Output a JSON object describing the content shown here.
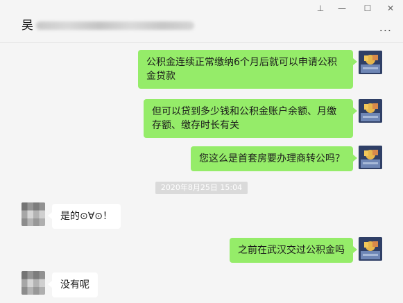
{
  "header": {
    "title": "吴",
    "more_label": "..."
  },
  "window_controls": {
    "pin": "⊥",
    "minimize": "—",
    "maximize": "☐",
    "close": "✕"
  },
  "messages": [
    {
      "from": "self",
      "text": "公积金连续正常缴纳6个月后就可以申请公积金贷款"
    },
    {
      "from": "self",
      "text": "但可以贷到多少钱和公积金账户余额、月缴存额、缴存时长有关"
    },
    {
      "from": "self",
      "text": "您这么是首套房要办理商转公吗？"
    },
    {
      "from": "other",
      "text": "是的⊙∀⊙！"
    },
    {
      "from": "self",
      "text": "之前在武汉交过公积金吗"
    },
    {
      "from": "other",
      "text": "没有呢"
    }
  ],
  "timestamp": "2020年8月25日 15:04",
  "colors": {
    "sent_bubble": "#95ec69",
    "recv_bubble": "#ffffff",
    "background": "#f5f5f5"
  }
}
